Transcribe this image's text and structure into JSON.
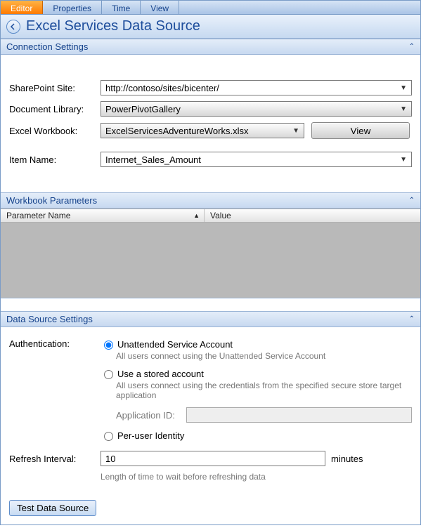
{
  "tabs": [
    "Editor",
    "Properties",
    "Time",
    "View"
  ],
  "title": "Excel Services Data Source",
  "sections": {
    "conn": "Connection Settings",
    "params": "Workbook Parameters",
    "dss": "Data Source Settings"
  },
  "conn": {
    "siteLabel": "SharePoint Site:",
    "siteValue": "http://contoso/sites/bicenter/",
    "libLabel": "Document Library:",
    "libValue": "PowerPivotGallery",
    "wbLabel": "Excel Workbook:",
    "wbValue": "ExcelServicesAdventureWorks.xlsx",
    "viewBtn": "View",
    "itemLabel": "Item Name:",
    "itemValue": "Internet_Sales_Amount"
  },
  "params": {
    "col1": "Parameter Name",
    "col2": "Value"
  },
  "dss": {
    "authLabel": "Authentication:",
    "opt1": "Unattended Service Account",
    "opt1desc": "All users connect using the Unattended Service Account",
    "opt2": "Use a stored account",
    "opt2desc": "All users connect using the credentials from the specified secure store target application",
    "appIdLabel": "Application ID:",
    "opt3": "Per-user Identity",
    "refreshLabel": "Refresh Interval:",
    "refreshValue": "10",
    "minutes": "minutes",
    "refreshDesc": "Length of time to wait before refreshing data"
  },
  "testBtn": "Test Data Source"
}
